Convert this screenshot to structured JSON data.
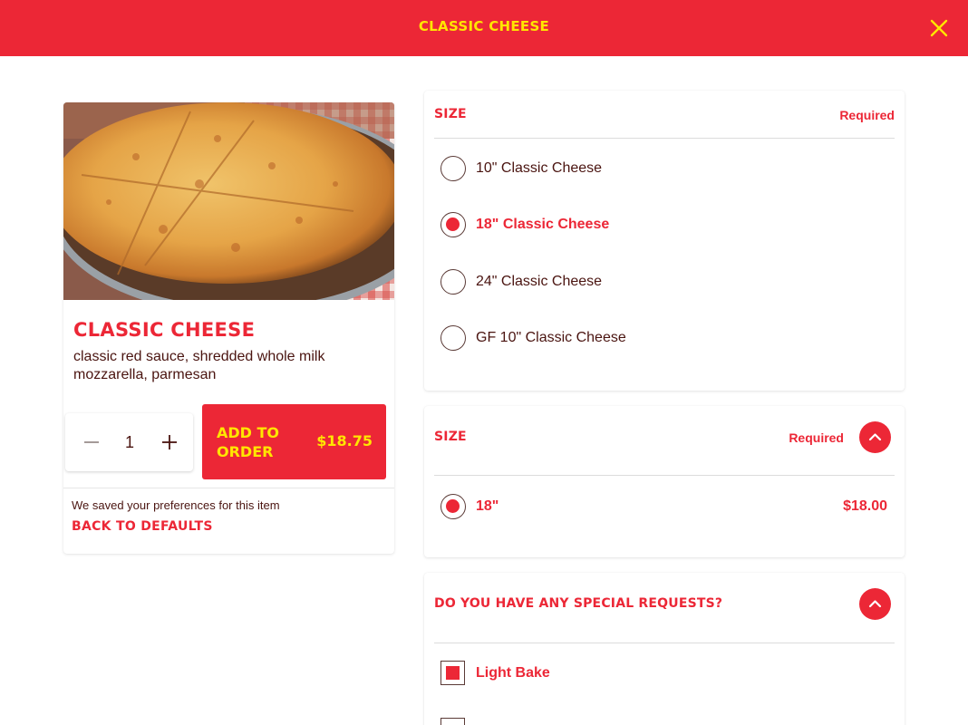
{
  "header": {
    "title": "CLASSIC CHEESE",
    "close_icon": "close-icon"
  },
  "colors": {
    "brand_red": "#ec2736",
    "brand_yellow": "#ffe600",
    "text_dark": "#4a1410"
  },
  "item": {
    "title": "CLASSIC CHEESE",
    "description": "classic red sauce, shredded whole milk mozzarella, parmesan",
    "image_alt": "Classic cheese pizza on a metal tray",
    "quantity": "1",
    "add_button_label": "ADD TO ORDER",
    "add_button_price": "$18.75",
    "saved_note": "We saved your preferences for this item",
    "back_to_defaults": "BACK TO DEFAULTS"
  },
  "size_section": {
    "title": "SIZE",
    "required_label": "Required",
    "options": [
      {
        "label": "10\" Classic Cheese",
        "selected": false
      },
      {
        "label": "18\" Classic Cheese",
        "selected": true
      },
      {
        "label": "24\" Classic Cheese",
        "selected": false
      },
      {
        "label": "GF 10\" Classic Cheese",
        "selected": false
      }
    ]
  },
  "size_section_2": {
    "title": "SIZE",
    "required_label": "Required",
    "options": [
      {
        "label": "18\"",
        "price": "$18.00",
        "selected": true
      }
    ]
  },
  "special_requests": {
    "title": "DO YOU HAVE ANY SPECIAL REQUESTS?",
    "options": [
      {
        "label": "Light Bake",
        "checked": true
      },
      {
        "label": "",
        "checked": false
      }
    ]
  }
}
